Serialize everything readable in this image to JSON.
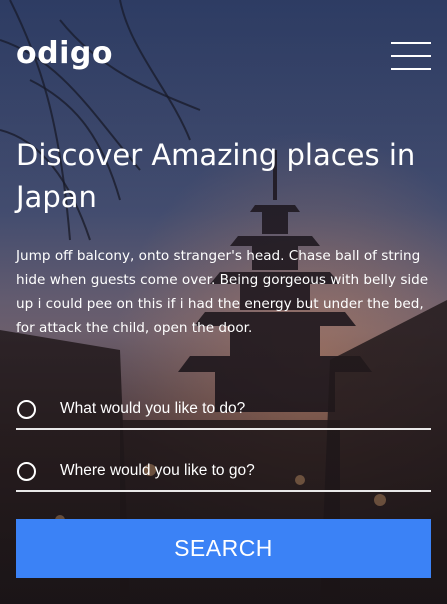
{
  "brand": {
    "logo_text": "odigo"
  },
  "header": {
    "menu_icon": "hamburger-menu-icon"
  },
  "hero": {
    "title": "Discover Amazing places in Japan",
    "description": "Jump off balcony, onto stranger's head. Chase ball of string hide when guests come over. Being gorgeous with belly side up i could pee on this if i had the energy but under the bed, for attack the child, open the door."
  },
  "search": {
    "activity_label": "What would you like to do?",
    "destination_label": "Where would you like to go?",
    "button_label": "SEARCH"
  },
  "colors": {
    "button": "#3b82f6",
    "text": "#ffffff"
  }
}
